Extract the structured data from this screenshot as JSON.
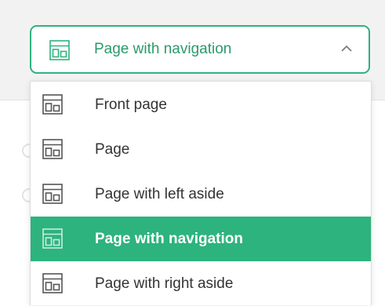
{
  "select": {
    "value": "Page with navigation",
    "icon": "page-layout-icon",
    "toggle_icon": "chevron-up-icon",
    "accent_color": "#2db37e"
  },
  "menu": {
    "items": [
      {
        "label": "Front page",
        "icon": "page-layout-icon",
        "selected": false
      },
      {
        "label": "Page",
        "icon": "page-layout-icon",
        "selected": false
      },
      {
        "label": "Page with left aside",
        "icon": "page-layout-icon",
        "selected": false
      },
      {
        "label": "Page with navigation",
        "icon": "page-layout-icon",
        "selected": true
      },
      {
        "label": "Page with right aside",
        "icon": "page-layout-icon",
        "selected": false
      }
    ],
    "selected_color": "#2db37e"
  }
}
